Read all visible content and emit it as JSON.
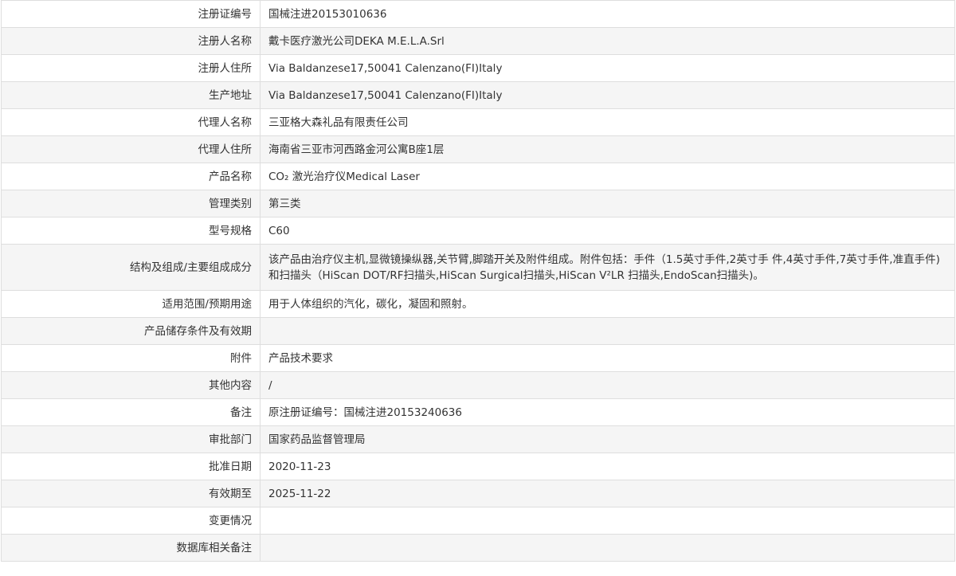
{
  "rows": [
    {
      "label": "注册证编号",
      "value": "国械注进20153010636"
    },
    {
      "label": "注册人名称",
      "value": "戴卡医疗激光公司DEKA M.E.L.A.Srl"
    },
    {
      "label": "注册人住所",
      "value": "Via Baldanzese17,50041 Calenzano(FI)Italy"
    },
    {
      "label": "生产地址",
      "value": "Via Baldanzese17,50041 Calenzano(FI)Italy"
    },
    {
      "label": "代理人名称",
      "value": "三亚格大森礼品有限责任公司"
    },
    {
      "label": "代理人住所",
      "value": "海南省三亚市河西路金河公寓B座1层"
    },
    {
      "label": "产品名称",
      "value": "CO₂ 激光治疗仪Medical Laser"
    },
    {
      "label": "管理类别",
      "value": "第三类"
    },
    {
      "label": "型号规格",
      "value": "C60"
    },
    {
      "label": "结构及组成/主要组成成分",
      "value": "该产品由治疗仪主机,显微镜操纵器,关节臂,脚踏开关及附件组成。附件包括：手件（1.5英寸手件,2英寸手 件,4英寸手件,7英寸手件,准直手件)和扫描头（HiScan DOT/RF扫描头,HiScan Surgical扫描头,HiScan V²LR 扫描头,EndoScan扫描头)。"
    },
    {
      "label": "适用范围/预期用途",
      "value": "用于人体组织的汽化，碳化，凝固和照射。"
    },
    {
      "label": "产品储存条件及有效期",
      "value": ""
    },
    {
      "label": "附件",
      "value": "产品技术要求"
    },
    {
      "label": "其他内容",
      "value": "/"
    },
    {
      "label": "备注",
      "value": "原注册证编号：国械注进20153240636"
    },
    {
      "label": "审批部门",
      "value": "国家药品监督管理局"
    },
    {
      "label": "批准日期",
      "value": "2020-11-23"
    },
    {
      "label": "有效期至",
      "value": "2025-11-22"
    },
    {
      "label": "变更情况",
      "value": ""
    },
    {
      "label": "数据库相关备注",
      "value": ""
    }
  ]
}
